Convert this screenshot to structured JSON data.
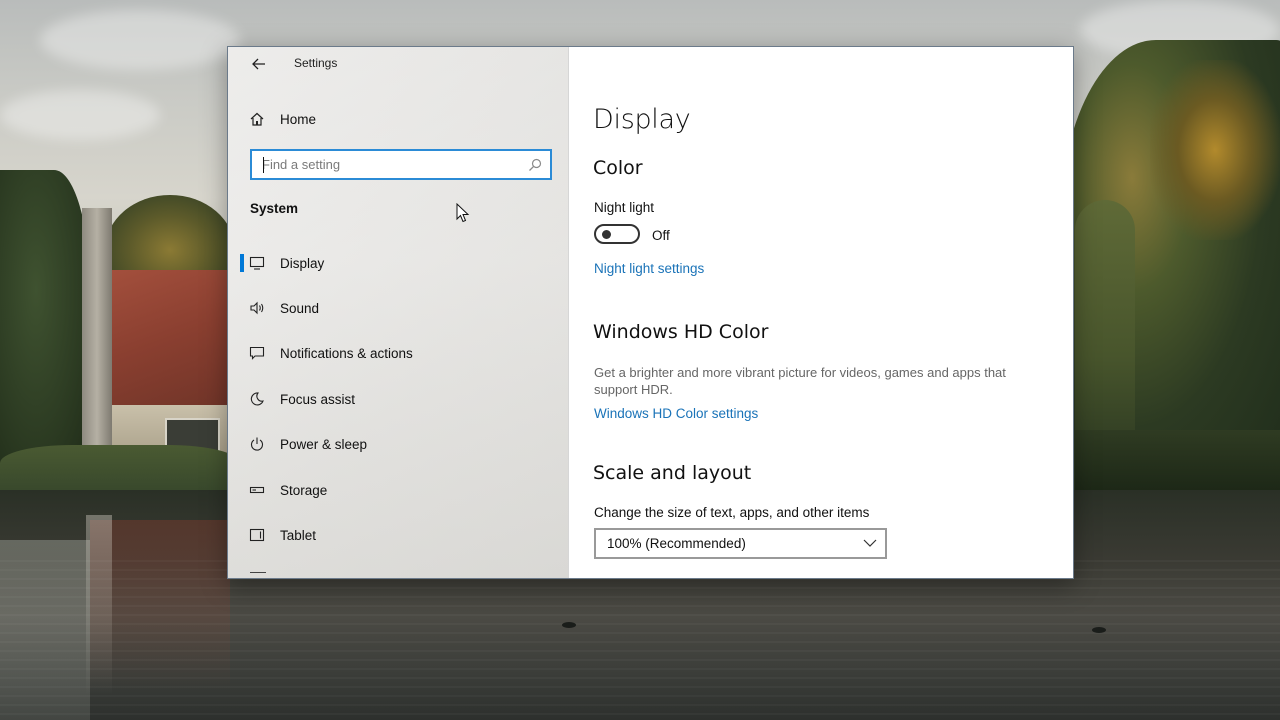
{
  "window": {
    "app_title": "Settings",
    "back_label": "←",
    "minimize_label": "",
    "maximize_label": "",
    "close_label": "✕"
  },
  "sidebar": {
    "home_label": "Home",
    "search": {
      "placeholder": "Find a setting",
      "value": ""
    },
    "section_label": "System",
    "items": [
      {
        "label": "Display",
        "icon": "monitor-icon",
        "selected": true
      },
      {
        "label": "Sound",
        "icon": "speaker-icon",
        "selected": false
      },
      {
        "label": "Notifications & actions",
        "icon": "notification-icon",
        "selected": false
      },
      {
        "label": "Focus assist",
        "icon": "moon-icon",
        "selected": false
      },
      {
        "label": "Power & sleep",
        "icon": "power-icon",
        "selected": false
      },
      {
        "label": "Storage",
        "icon": "storage-icon",
        "selected": false
      },
      {
        "label": "Tablet",
        "icon": "tablet-icon",
        "selected": false
      }
    ]
  },
  "main": {
    "page_title": "Display",
    "color_heading": "Color",
    "night_light_label": "Night light",
    "night_light_state": "Off",
    "night_light_on": false,
    "night_light_settings_link": "Night light settings",
    "hd_color_heading": "Windows HD Color",
    "hd_color_description": "Get a brighter and more vibrant picture for videos, games and apps that support HDR.",
    "hd_color_settings_link": "Windows HD Color settings",
    "scale_heading": "Scale and layout",
    "scale_label": "Change the size of text, apps, and other items",
    "scale_value": "100% (Recommended)"
  },
  "colors": {
    "accent": "#0078d7",
    "link": "#1a73b8",
    "search_border": "#2b8bd6"
  }
}
